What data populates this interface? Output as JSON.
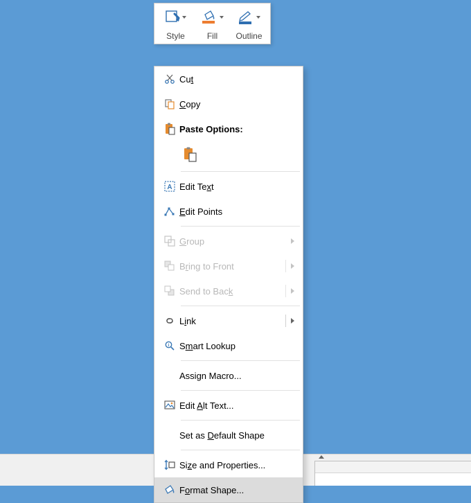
{
  "toolbar": {
    "style": "Style",
    "fill": "Fill",
    "outline": "Outline"
  },
  "menu": {
    "cut": "Cu<u>t</u>",
    "copy": "<u>C</u>opy",
    "paste_options": "Paste Options:",
    "edit_text": "Edit Te<u>x</u>t",
    "edit_points": "<u>E</u>dit Points",
    "group": "<u>G</u>roup",
    "bring_front": "B<u>r</u>ing to Front",
    "send_back": "Send to Bac<u>k</u>",
    "link": "L<u>i</u>nk",
    "smart_lookup": "S<u>m</u>art Lookup",
    "assign_macro": "Assi<u>g</u>n Macro...",
    "alt_text": "Edit <u>A</u>lt Text...",
    "default_shape": "Set as <u>D</u>efault Shape",
    "size_props": "Si<u>z</u>e and Properties...",
    "format_shape": "F<u>o</u>rmat Shape..."
  }
}
